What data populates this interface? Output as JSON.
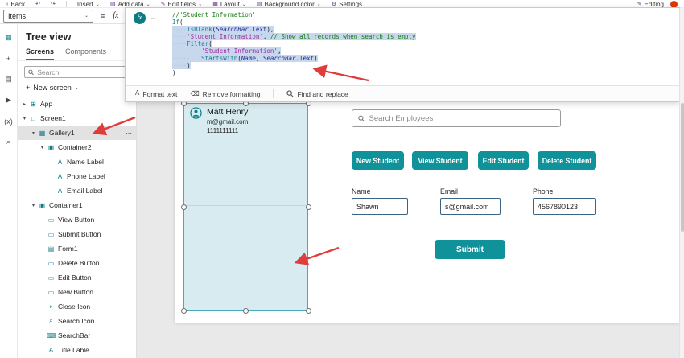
{
  "colors": {
    "teal": "#10929b",
    "teal-dark": "#0c7b83",
    "gallery-fill": "#d8ebf1",
    "gallery-border": "#49a9b4",
    "arrow-red": "#e03c3c",
    "code-selection": "#c7d7ee",
    "avatar-orange": "#d83b01"
  },
  "command_bar": {
    "items": [
      {
        "name": "back",
        "label": "Back",
        "glyph": "‹"
      },
      {
        "name": "undo",
        "glyph": "↶"
      },
      {
        "name": "redo",
        "glyph": "↷"
      },
      {
        "divider": true
      },
      {
        "name": "insert",
        "label": "Insert",
        "chevron": true
      },
      {
        "name": "add-data",
        "label": "Add data",
        "glyph": "▤",
        "chevron": true
      },
      {
        "name": "edit-fields",
        "label": "Edit fields",
        "glyph": "✎",
        "chevron": true
      },
      {
        "name": "layout",
        "label": "Layout",
        "glyph": "▦",
        "chevron": true
      },
      {
        "name": "background-color",
        "label": "Background color",
        "glyph": "▧",
        "chevron": true
      },
      {
        "name": "settings",
        "label": "Settings",
        "glyph": "⚙"
      }
    ],
    "editing_label": "Editing"
  },
  "property_bar": {
    "selector_value": "Items",
    "fx_label": "fx"
  },
  "formula": {
    "badge": "fx",
    "lines": [
      {
        "selected": false,
        "tokens": [
          {
            "t": "//'Student Information'",
            "y": "comment"
          }
        ]
      },
      {
        "selected": false,
        "tokens": [
          {
            "t": "If",
            "y": "func"
          },
          {
            "t": "(",
            "y": "plain"
          }
        ]
      },
      {
        "selected": true,
        "tokens": [
          {
            "t": "····",
            "y": "ws"
          },
          {
            "t": "IsBlank",
            "y": "func"
          },
          {
            "t": "(",
            "y": "plain"
          },
          {
            "t": "SearchBar",
            "y": "control"
          },
          {
            "t": ".",
            "y": "plain"
          },
          {
            "t": "Text",
            "y": "prop"
          },
          {
            "t": "),",
            "y": "plain"
          }
        ]
      },
      {
        "selected": true,
        "tokens": [
          {
            "t": "····",
            "y": "ws"
          },
          {
            "t": "'Student Information'",
            "y": "string"
          },
          {
            "t": ", ",
            "y": "plain"
          },
          {
            "t": "// Show all records when search is empty",
            "y": "comment"
          }
        ]
      },
      {
        "selected": true,
        "tokens": [
          {
            "t": "····",
            "y": "ws"
          },
          {
            "t": "Filter",
            "y": "func"
          },
          {
            "t": "(",
            "y": "plain"
          }
        ]
      },
      {
        "selected": true,
        "tokens": [
          {
            "t": "········",
            "y": "ws"
          },
          {
            "t": "'Student Information'",
            "y": "string"
          },
          {
            "t": ",",
            "y": "plain"
          }
        ]
      },
      {
        "selected": true,
        "tokens": [
          {
            "t": "········",
            "y": "ws"
          },
          {
            "t": "StartsWith",
            "y": "func"
          },
          {
            "t": "(",
            "y": "plain"
          },
          {
            "t": "Name",
            "y": "control"
          },
          {
            "t": ", ",
            "y": "plain"
          },
          {
            "t": "SearchBar",
            "y": "control"
          },
          {
            "t": ".",
            "y": "plain"
          },
          {
            "t": "Text",
            "y": "prop"
          },
          {
            "t": ")",
            "y": "plain"
          }
        ]
      },
      {
        "selected": true,
        "tokens": [
          {
            "t": "····",
            "y": "ws"
          },
          {
            "t": ")",
            "y": "plain"
          }
        ]
      },
      {
        "selected": false,
        "tokens": [
          {
            "t": ")",
            "y": "plain"
          }
        ]
      }
    ]
  },
  "formula_toolbar": {
    "format_text": "Format text",
    "remove_formatting": "Remove formatting",
    "find_replace": "Find and replace"
  },
  "left_rail": {
    "icons": [
      {
        "name": "tree-view",
        "glyph": "▦",
        "active": true
      },
      {
        "name": "insert-plus",
        "glyph": "+"
      },
      {
        "name": "data",
        "glyph": "▤"
      },
      {
        "name": "media",
        "glyph": "▶"
      },
      {
        "name": "variables",
        "glyph": "(x)"
      },
      {
        "name": "search",
        "glyph": "⌕"
      },
      {
        "name": "more",
        "glyph": "⋯"
      }
    ]
  },
  "tree": {
    "title": "Tree view",
    "tabs": [
      "Screens",
      "Components"
    ],
    "search_placeholder": "Search",
    "new_screen_label": "New screen",
    "items": [
      {
        "label": "App",
        "depth": 0,
        "icon": "app",
        "glyph": "⊞",
        "chevron": "right"
      },
      {
        "label": "Screen1",
        "depth": 0,
        "icon": "screen",
        "glyph": "□",
        "chevron": "down"
      },
      {
        "label": "Gallery1",
        "depth": 1,
        "icon": "gallery",
        "glyph": "▦",
        "chevron": "down",
        "selected": true,
        "menu": true
      },
      {
        "label": "Container2",
        "depth": 2,
        "icon": "container",
        "glyph": "▣",
        "chevron": "down"
      },
      {
        "label": "Name Label",
        "depth": 3,
        "icon": "label",
        "glyph": "A"
      },
      {
        "label": "Phone Label",
        "depth": 3,
        "icon": "label",
        "glyph": "A"
      },
      {
        "label": "Email Label",
        "depth": 3,
        "icon": "label",
        "glyph": "A"
      },
      {
        "label": "Container1",
        "depth": 1,
        "icon": "container",
        "glyph": "▣",
        "chevron": "down"
      },
      {
        "label": "View Button",
        "depth": 2,
        "icon": "button",
        "glyph": "▭"
      },
      {
        "label": "Submit Button",
        "depth": 2,
        "icon": "button",
        "glyph": "▭"
      },
      {
        "label": "Form1",
        "depth": 2,
        "icon": "form",
        "glyph": "▤"
      },
      {
        "label": "Delete Button",
        "depth": 2,
        "icon": "button",
        "glyph": "▭"
      },
      {
        "label": "Edit Button",
        "depth": 2,
        "icon": "button",
        "glyph": "▭"
      },
      {
        "label": "New Button",
        "depth": 2,
        "icon": "button",
        "glyph": "▭"
      },
      {
        "label": "Close Icon",
        "depth": 2,
        "icon": "close-shape",
        "glyph": "×"
      },
      {
        "label": "Search Icon",
        "depth": 2,
        "icon": "search-shape",
        "glyph": "⌕"
      },
      {
        "label": "SearchBar",
        "depth": 2,
        "icon": "text-input",
        "glyph": "⌨"
      },
      {
        "label": "Title Lable",
        "depth": 2,
        "icon": "label",
        "glyph": "A"
      }
    ]
  },
  "canvas": {
    "search_placeholder": "Search Employees",
    "gallery": {
      "name": "Matt Henry",
      "email": "m@gmail.com",
      "phone": "1111111111"
    },
    "action_buttons": [
      "New Student",
      "View Student",
      "Edit Student",
      "Delete Student"
    ],
    "fields": [
      {
        "label": "Name",
        "value": "Shawn"
      },
      {
        "label": "Email",
        "value": "s@gmail.com"
      },
      {
        "label": "Phone",
        "value": "4567890123"
      }
    ],
    "submit_label": "Submit"
  }
}
